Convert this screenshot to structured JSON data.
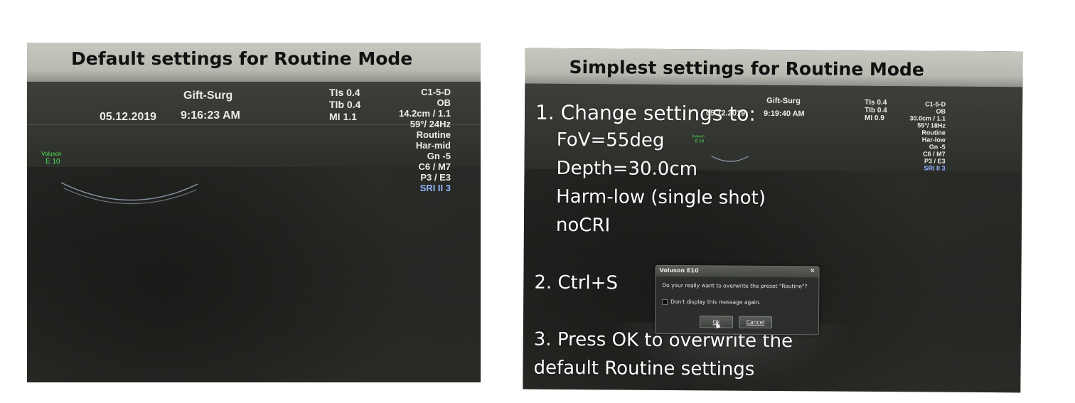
{
  "left_panel": {
    "title": "Default settings for Routine Mode",
    "screen": {
      "patient_name": "Gift-Surg",
      "date": "05.12.2019",
      "time": "9:16:23 AM",
      "indices": [
        "TIs  0.4",
        "TIb  0.4",
        "MI  1.1"
      ],
      "logo_line1": "Voluson",
      "logo_line2": "E 10",
      "params": [
        "C1-5-D",
        "OB",
        "14.2cm / 1.1",
        "59°/ 24Hz",
        "Routine",
        "Har-mid",
        "Gn  -5",
        "C6 / M7",
        "P3 / E3"
      ],
      "sri": "SRI II 3"
    }
  },
  "right_panel": {
    "title": "Simplest settings for Routine Mode",
    "screen": {
      "patient_name": "Gift-Surg",
      "date": "05.12.2019",
      "time": "9:19:40 AM",
      "indices": [
        "TIs  0.4",
        "TIb  0.4",
        "MI  0.9"
      ],
      "logo_line1": "Voluson",
      "logo_line2": "E 10",
      "params": [
        "C1-5-D",
        "OB",
        "30.0cm / 1.1",
        "55°/ 18Hz",
        "Routine",
        "Har-low",
        "Gn  -5",
        "C6 / M7",
        "P3 / E3"
      ],
      "sri": "SRI II 3"
    },
    "instructions": {
      "step1_heading": "1. Change settings to:",
      "step1_items": [
        "FoV=55deg",
        "Depth=30.0cm",
        "Harm-low (single shot)",
        "noCRI"
      ],
      "step2": "2. Ctrl+S",
      "step3_line1": "3. Press OK to overwrite the",
      "step3_line2": "default Routine settings"
    },
    "dialog": {
      "title": "Voluson E10",
      "close": "×",
      "message": "Do your really want to overwrite the preset \"Routine\"?",
      "checkbox_label": "Don't display this message again.",
      "ok": "Ok",
      "cancel": "Cancel"
    }
  },
  "colors": {
    "overlay_text": "#111111",
    "instruction_text": "#ffffff",
    "screen_text": "#e9ebe6",
    "sri_text": "#8fb4ff",
    "logo_text": "#4ee85a"
  }
}
